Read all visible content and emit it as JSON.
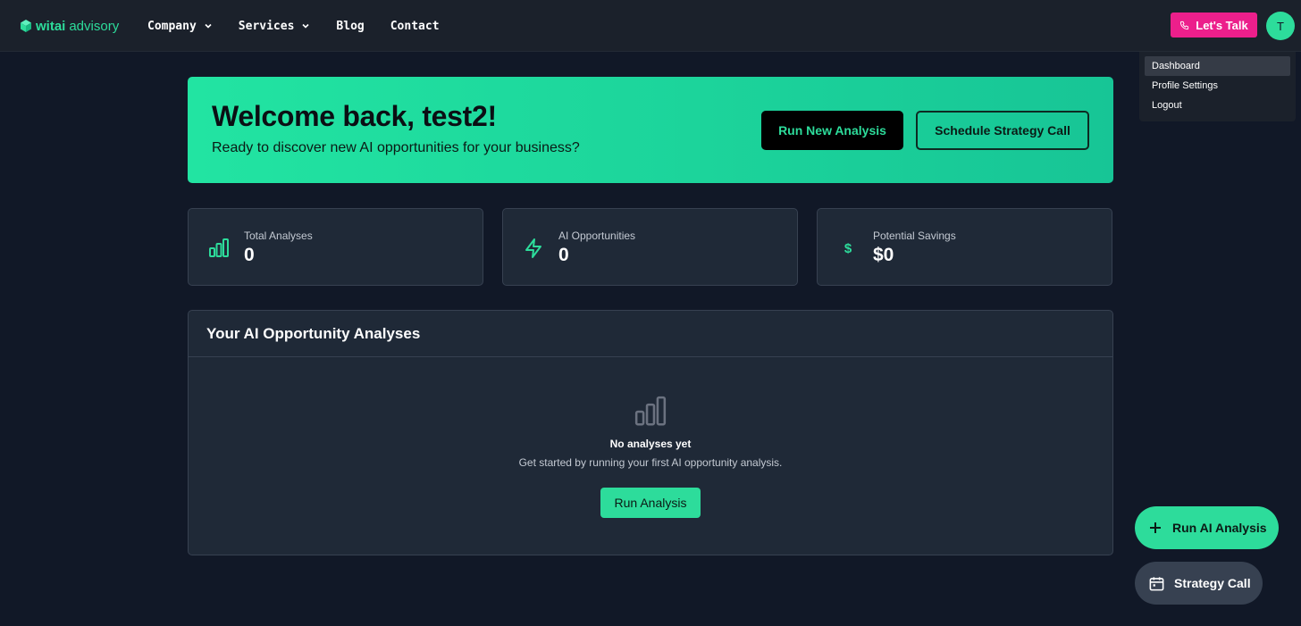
{
  "nav": {
    "logo_brand": "witai",
    "logo_suffix": "advisory",
    "links": [
      {
        "label": "Company"
      },
      {
        "label": "Services"
      },
      {
        "label": "Blog"
      },
      {
        "label": "Contact"
      }
    ],
    "cta_label": "Let's Talk",
    "avatar_initial": "T"
  },
  "user_menu": {
    "items": [
      {
        "label": "Dashboard",
        "active": true
      },
      {
        "label": "Profile Settings"
      },
      {
        "label": "Logout"
      }
    ]
  },
  "hero": {
    "title": "Welcome back, test2!",
    "subtitle": "Ready to discover new AI opportunities for your business?",
    "primary_button": "Run New Analysis",
    "secondary_button": "Schedule Strategy Call"
  },
  "stats": [
    {
      "label": "Total Analyses",
      "value": "0",
      "icon": "bar-chart-icon"
    },
    {
      "label": "AI Opportunities",
      "value": "0",
      "icon": "lightning-icon"
    },
    {
      "label": "Potential Savings",
      "value": "$0",
      "icon": "dollar-icon"
    }
  ],
  "analyses": {
    "title": "Your AI Opportunity Analyses",
    "empty_title": "No analyses yet",
    "empty_subtitle": "Get started by running your first AI opportunity analysis.",
    "button": "Run Analysis"
  },
  "floating": {
    "run_label": "Run AI Analysis",
    "call_label": "Strategy Call"
  },
  "colors": {
    "accent": "#2ddc9b",
    "cta_pink": "#ec1f8b",
    "background": "#111827",
    "card": "#1f2937"
  }
}
